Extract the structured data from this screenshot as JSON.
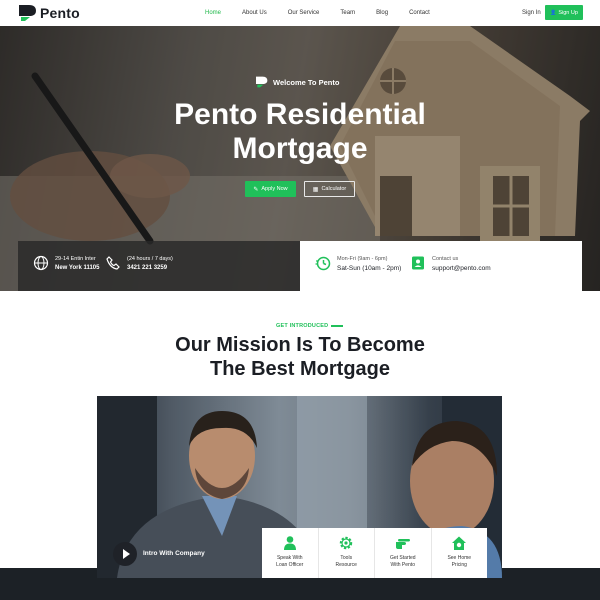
{
  "brand": {
    "name": "Pento",
    "accent": "#20c05a",
    "dark": "#1b1e24"
  },
  "nav": {
    "items": [
      {
        "label": "Home",
        "active": true
      },
      {
        "label": "About Us",
        "active": false
      },
      {
        "label": "Our Service",
        "active": false
      },
      {
        "label": "Team",
        "active": false
      },
      {
        "label": "Blog",
        "active": false
      },
      {
        "label": "Contact",
        "active": false
      }
    ],
    "signin": "Sign In",
    "signup": "Sign Up"
  },
  "hero": {
    "welcome": "Welcome To Pento",
    "title_line1": "Pento Residential",
    "title_line2": "Mortgage",
    "apply": "Apply Now",
    "calculator": "Calculator"
  },
  "contact": {
    "address_line1": "29-14 Entin Inter",
    "address_line2": "New York 11105",
    "phone_hours": "(24 hours / 7 days)",
    "phone": "3421 221 3259",
    "hours_line1": "Mon-Fri (9am - 6pm)",
    "hours_line2": "Sat-Sun (10am - 2pm)",
    "contact_label": "Contact us",
    "email": "support@pento.com"
  },
  "mission": {
    "tag": "GET INTRODUCED",
    "line1": "Our Mission Is To Become",
    "line2": "The Best Mortgage"
  },
  "video": {
    "label": "Intro With Company"
  },
  "cards": [
    {
      "line1": "Speak With",
      "line2": "Loan Officer",
      "icon": "person-icon"
    },
    {
      "line1": "Tools",
      "line2": "Resource",
      "icon": "gear-icon"
    },
    {
      "line1": "Get Started",
      "line2": "With Pento",
      "icon": "pointing-hand-icon"
    },
    {
      "line1": "See Home",
      "line2": "Pricing",
      "icon": "home-price-icon"
    }
  ]
}
